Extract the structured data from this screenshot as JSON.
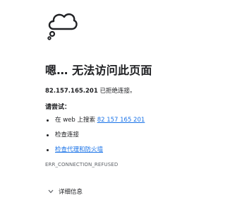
{
  "error_page": {
    "icon": "thought-cloud-icon",
    "title": "嗯… 无法访问此页面",
    "host": "82.157.165.201",
    "message": "已拒绝连接。",
    "try_heading": "请尝试：",
    "suggestions": [
      {
        "prefix": "在 web 上搜索",
        "link": "82 157 165 201"
      },
      {
        "text": "检查连接"
      },
      {
        "link": "检查代理和防火墙"
      }
    ],
    "error_code": "ERR_CONNECTION_REFUSED",
    "details_label": "详细信息",
    "link_color": "#1a73e8"
  }
}
